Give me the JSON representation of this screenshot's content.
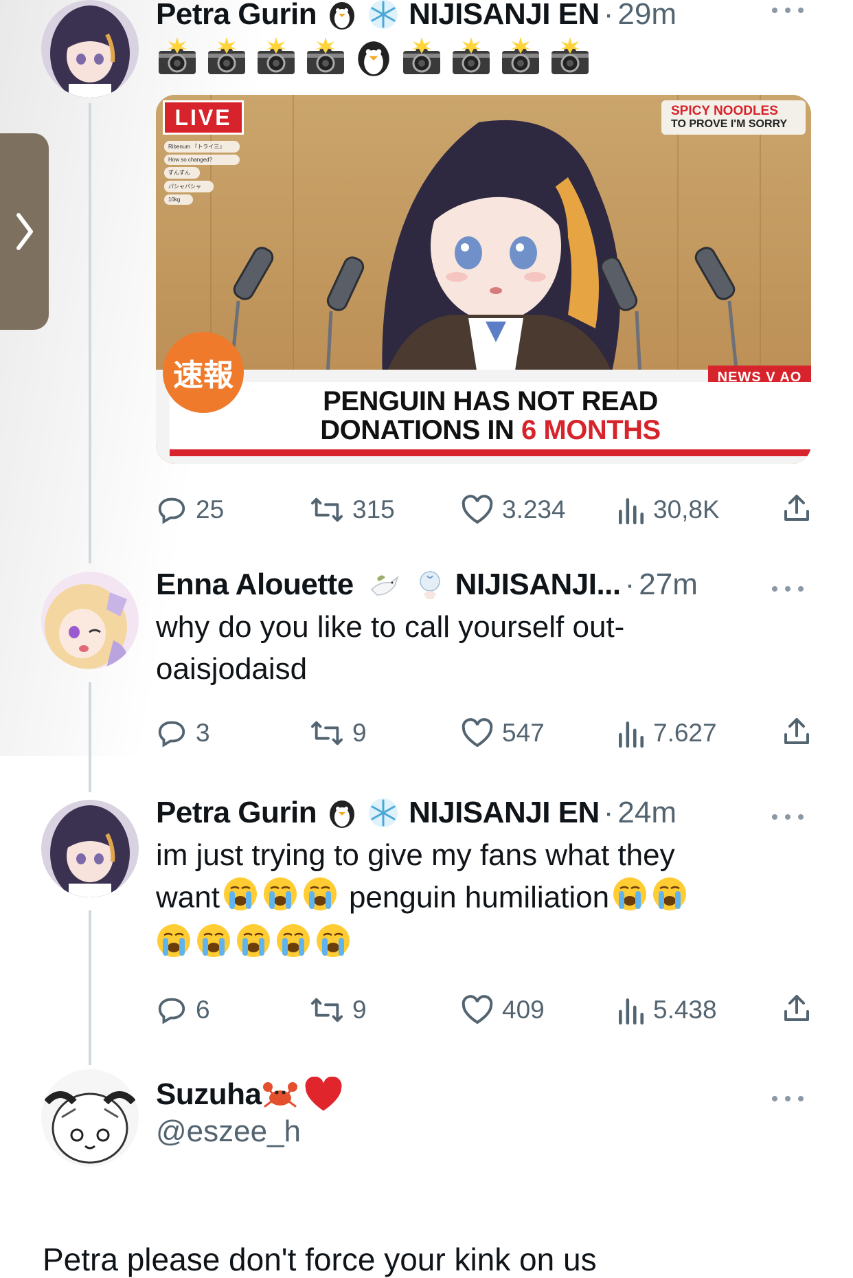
{
  "side_tab": {
    "icon": "chevron-right-icon"
  },
  "tweets": [
    {
      "name": "Petra Gurin",
      "badges": [
        "penguin-emoji",
        "snowflake-emoji"
      ],
      "affiliation": "NIJISANJI EN",
      "time": "29m",
      "emoji_line": [
        "camera-flash-emoji",
        "camera-flash-emoji",
        "camera-flash-emoji",
        "camera-flash-emoji",
        "penguin-emoji",
        "camera-flash-emoji",
        "camera-flash-emoji",
        "camera-flash-emoji",
        "camera-flash-emoji"
      ],
      "media": {
        "live": "LIVE",
        "top_right_1": "SPICY NOODLES",
        "top_right_2": "TO PROVE I'M SORRY",
        "breaking_badge": "速報",
        "news_tag": "NEWS V AO",
        "headline_1": "PENGUIN HAS NOT READ",
        "headline_2a": "DONATIONS IN ",
        "headline_2b": "6 MONTHS",
        "chat": [
          "Ribenum 『トライ三』",
          "How so changed?",
          "ずんずん",
          "パシャパシャ",
          "10kg"
        ]
      },
      "stats": {
        "replies": "25",
        "retweets": "315",
        "likes": "3.234",
        "views": "30,8K"
      }
    },
    {
      "name": "Enna Alouette",
      "badges": [
        "dove-emoji",
        "angel-wing-emoji"
      ],
      "affiliation": "NIJISANJI...",
      "time": "27m",
      "text_1": "why do you like to call yourself out-",
      "text_2": "oaisjodaisd",
      "stats": {
        "replies": "3",
        "retweets": "9",
        "likes": "547",
        "views": "7.627"
      }
    },
    {
      "name": "Petra Gurin",
      "badges": [
        "penguin-emoji",
        "snowflake-emoji"
      ],
      "affiliation": "NIJISANJI EN",
      "time": "24m",
      "text_1": "im just trying to give my fans what they",
      "text_2a": "want",
      "text_2b": "penguin humiliation",
      "stats": {
        "replies": "6",
        "retweets": "9",
        "likes": "409",
        "views": "5.438"
      }
    }
  ],
  "reply_author": {
    "name": "Suzuha",
    "badges": [
      "crab-emoji",
      "red-heart-emoji"
    ],
    "handle": "@eszee_h"
  },
  "reply_text": "Petra please don't force your kink on us",
  "colors": {
    "muted": "#536471",
    "line": "#cfd9de",
    "accent_red": "#e0262c",
    "side_tab": "#7d705f"
  }
}
